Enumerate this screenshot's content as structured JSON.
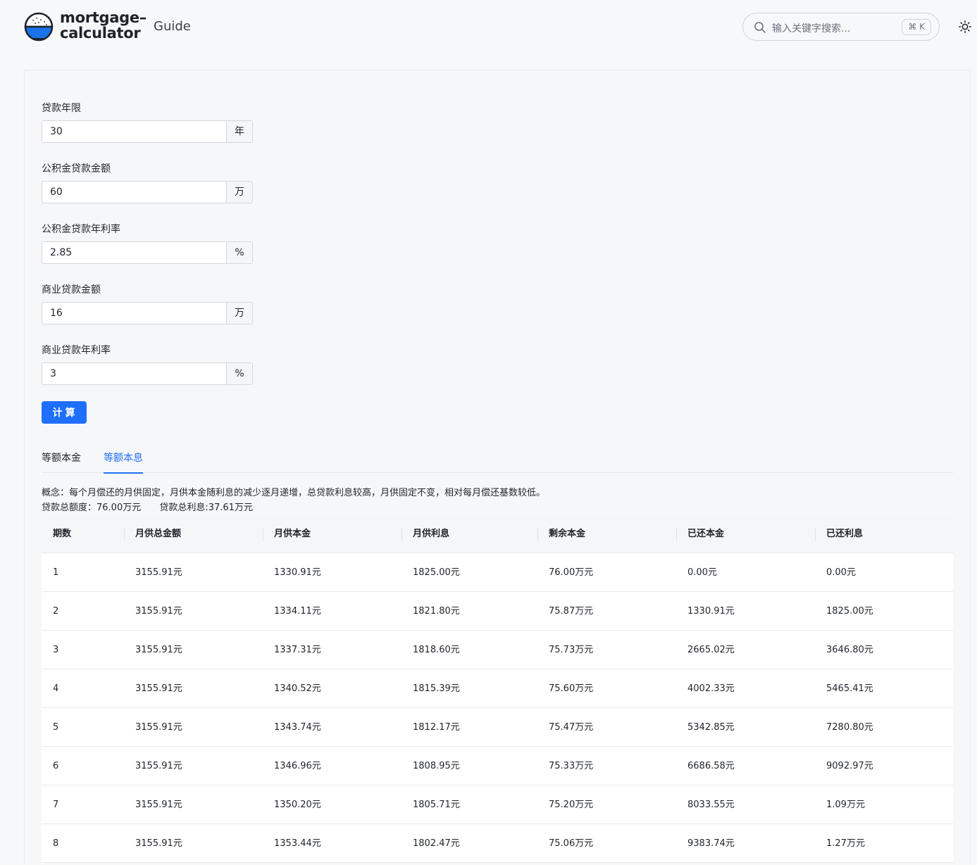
{
  "header": {
    "brand_line1": "mortgage–",
    "brand_line2": "calculator",
    "guide": "Guide",
    "search_placeholder": "输入关键字搜索...",
    "search_shortcut": "⌘ K"
  },
  "form": {
    "years_label": "贷款年限",
    "years_value": "30",
    "years_unit": "年",
    "fund_amount_label": "公积金贷款金额",
    "fund_amount_value": "60",
    "fund_amount_unit": "万",
    "fund_rate_label": "公积金贷款年利率",
    "fund_rate_value": "2.85",
    "fund_rate_unit": "%",
    "biz_amount_label": "商业贷款金额",
    "biz_amount_value": "16",
    "biz_amount_unit": "万",
    "biz_rate_label": "商业贷款年利率",
    "biz_rate_value": "3",
    "biz_rate_unit": "%",
    "calc_button": "计算"
  },
  "tabs": [
    {
      "label": "等额本金",
      "active": false
    },
    {
      "label": "等额本息",
      "active": true
    }
  ],
  "summary": {
    "concept": "概念：每个月偿还的月供固定，月供本金随利息的减少逐月递增，总贷款利息较高，月供固定不变，相对每月偿还基数较低。",
    "total_loan": "贷款总额度：76.00万元",
    "total_interest": "贷款总利息:37.61万元"
  },
  "table": {
    "headers": [
      "期数",
      "月供总金额",
      "月供本金",
      "月供利息",
      "剩余本金",
      "已还本金",
      "已还利息"
    ],
    "rows": [
      [
        "1",
        "3155.91元",
        "1330.91元",
        "1825.00元",
        "76.00万元",
        "0.00元",
        "0.00元"
      ],
      [
        "2",
        "3155.91元",
        "1334.11元",
        "1821.80元",
        "75.87万元",
        "1330.91元",
        "1825.00元"
      ],
      [
        "3",
        "3155.91元",
        "1337.31元",
        "1818.60元",
        "75.73万元",
        "2665.02元",
        "3646.80元"
      ],
      [
        "4",
        "3155.91元",
        "1340.52元",
        "1815.39元",
        "75.60万元",
        "4002.33元",
        "5465.41元"
      ],
      [
        "5",
        "3155.91元",
        "1343.74元",
        "1812.17元",
        "75.47万元",
        "5342.85元",
        "7280.80元"
      ],
      [
        "6",
        "3155.91元",
        "1346.96元",
        "1808.95元",
        "75.33万元",
        "6686.58元",
        "9092.97元"
      ],
      [
        "7",
        "3155.91元",
        "1350.20元",
        "1805.71元",
        "75.20万元",
        "8033.55元",
        "1.09万元"
      ],
      [
        "8",
        "3155.91元",
        "1353.44元",
        "1802.47元",
        "75.06万元",
        "9383.74元",
        "1.27万元"
      ]
    ]
  },
  "colors": {
    "accent": "#1f6fff",
    "logo_blue": "#1a73e8"
  },
  "icons": {
    "logo": "rice-bowl-logo-icon",
    "search": "search-icon",
    "theme": "sun-icon"
  }
}
